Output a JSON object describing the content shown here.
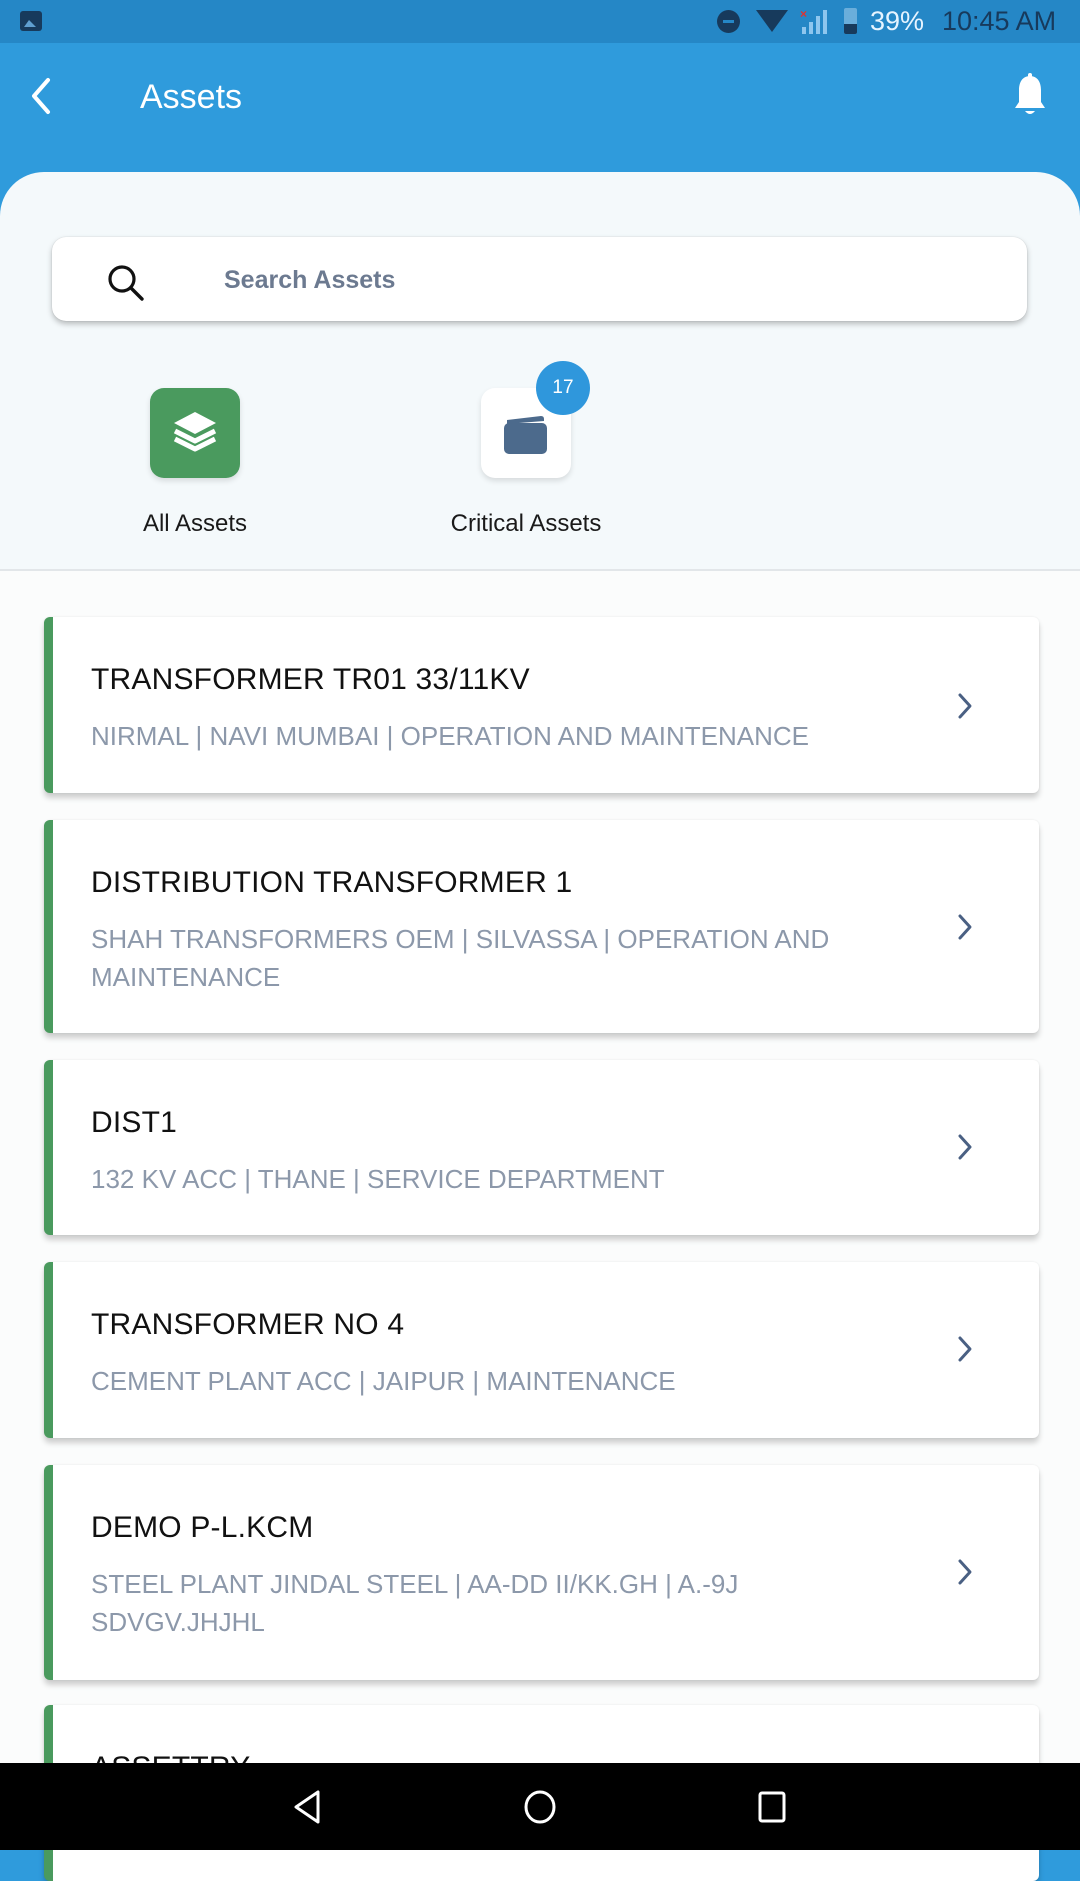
{
  "status_bar": {
    "battery_percent": "39%",
    "battery_level": 0.39,
    "time": "10:45 AM",
    "icons": [
      "gallery-icon",
      "do-not-disturb-icon",
      "wifi-icon",
      "signal-no-sim-icon",
      "battery-icon"
    ]
  },
  "header": {
    "title": "Assets",
    "back_icon": "chevron-left-icon",
    "notification_icon": "bell-icon"
  },
  "search": {
    "placeholder": "Search Assets",
    "value": "",
    "icon": "search-icon"
  },
  "quick_access": [
    {
      "label": "All Assets",
      "icon": "layers-icon",
      "color": "#4a9a5e"
    },
    {
      "label": "Critical Assets",
      "icon": "folder-icon",
      "badge": "17",
      "badge_color": "#2f97dc"
    }
  ],
  "assets": [
    {
      "title": "TRANSFORMER TR01 33/11KV",
      "subtitle": "NIRMAL | NAVI MUMBAI | OPERATION AND MAINTENANCE"
    },
    {
      "title": "DISTRIBUTION TRANSFORMER 1",
      "subtitle": "SHAH TRANSFORMERS OEM | SILVASSA | OPERATION AND MAINTENANCE"
    },
    {
      "title": "DIST1",
      "subtitle": "132 KV ACC | THANE | SERVICE DEPARTMENT"
    },
    {
      "title": "TRANSFORMER NO 4",
      "subtitle": "CEMENT PLANT ACC | JAIPUR | MAINTENANCE"
    },
    {
      "title": "DEMO P-L.KCM",
      "subtitle": "STEEL PLANT JINDAL STEEL | AA-DD II/KK.GH | A.-9J SDVGV.JHJHL"
    },
    {
      "title": "ASSETTRY",
      "subtitle": ""
    }
  ],
  "colors": {
    "header_blue": "#2f9bdc",
    "status_bar_blue": "#2587c6",
    "accent_green": "#4a9a5e",
    "chevron": "#4a6083",
    "subtitle_gray": "#8c98aa"
  },
  "nav_bar": {
    "buttons": [
      "back-triangle-icon",
      "home-circle-icon",
      "recents-square-icon"
    ]
  }
}
